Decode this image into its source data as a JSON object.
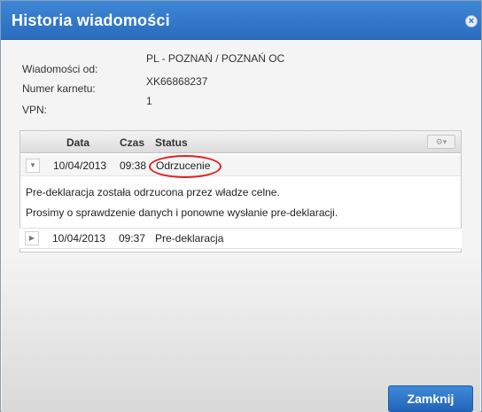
{
  "dialog": {
    "title": "Historia wiadomości",
    "close_icon": "close-icon"
  },
  "info": [
    {
      "label": "Wiadomości od:",
      "value": "PL - POZNAŃ / POZNAŃ OC"
    },
    {
      "label": "Numer karnetu:",
      "value": "XK66868237"
    },
    {
      "label": "VPN:",
      "value": "1"
    }
  ],
  "grid": {
    "headers": {
      "date": "Data",
      "time": "Czas",
      "status": "Status"
    },
    "settings_icon": "gear-icon",
    "rows": [
      {
        "date": "10/04/2013",
        "time": "09:38",
        "status": "Odrzucenie",
        "expanded": true,
        "details": [
          "Pre-deklaracja została odrzucona przez władze celne.",
          "Prosimy o sprawdzenie danych i ponowne wysłanie pre-deklaracji."
        ]
      },
      {
        "date": "10/04/2013",
        "time": "09:37",
        "status": "Pre-deklaracja",
        "expanded": false
      }
    ]
  },
  "footer": {
    "close_label": "Zamknij"
  },
  "colors": {
    "accent": "#2a6cbd",
    "highlight": "#e02020"
  }
}
